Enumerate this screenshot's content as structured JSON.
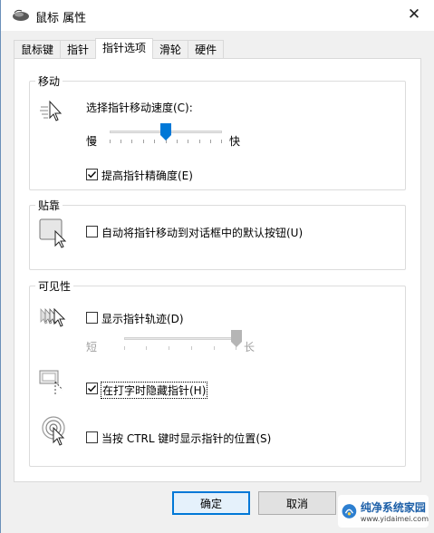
{
  "window": {
    "title": "鼠标 属性",
    "close_glyph": "✕"
  },
  "tabs": [
    {
      "label": "鼠标键"
    },
    {
      "label": "指针"
    },
    {
      "label": "指针选项",
      "active": true
    },
    {
      "label": "滑轮"
    },
    {
      "label": "硬件"
    }
  ],
  "motion": {
    "group_title": "移动",
    "speed_label": "选择指针移动速度(C):",
    "slow_label": "慢",
    "fast_label": "快",
    "speed_level": 0.5,
    "enhance_label": "提高指针精确度(E)",
    "enhance_checked": true
  },
  "snap": {
    "group_title": "贴靠",
    "snap_label": "自动将指针移动到对话框中的默认按钮(U)",
    "snap_checked": false
  },
  "visibility": {
    "group_title": "可见性",
    "trails_label": "显示指针轨迹(D)",
    "trails_checked": false,
    "short_label": "短",
    "long_label": "长",
    "trail_level": 1.0,
    "hide_label": "在打字时隐藏指针(H)",
    "hide_checked": true,
    "ctrl_label": "当按 CTRL 键时显示指针的位置(S)",
    "ctrl_checked": false
  },
  "buttons": {
    "ok_label": "确定",
    "cancel_label": "取消"
  },
  "watermark": {
    "title": "纯净系统家园",
    "url": "www.yidaimei.com"
  },
  "colors": {
    "accent": "#0078d7",
    "thumb": "#0078d7",
    "disabled_thumb": "#b5b5b5"
  }
}
